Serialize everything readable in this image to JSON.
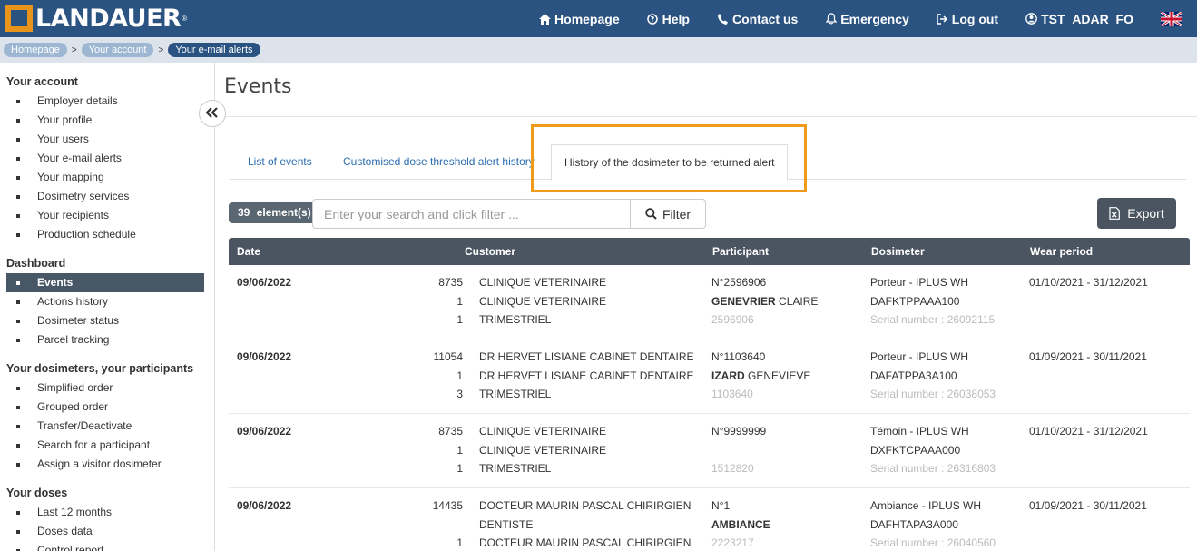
{
  "brand": {
    "name": "LANDAUER",
    "reg": "®"
  },
  "nav": {
    "homepage": "Homepage",
    "help": "Help",
    "contact": "Contact us",
    "emergency": "Emergency",
    "logout": "Log out",
    "user": "TST_ADAR_FO"
  },
  "breadcrumb": [
    "Homepage",
    "Your account",
    "Your e-mail alerts"
  ],
  "sidebar": {
    "sections": [
      {
        "title": "Your account",
        "items": [
          "Employer details",
          "Your profile",
          "Your users",
          "Your e-mail alerts",
          "Your mapping",
          "Dosimetry services",
          "Your recipients",
          "Production schedule"
        ]
      },
      {
        "title": "Dashboard",
        "items": [
          "Events",
          "Actions history",
          "Dosimeter status",
          "Parcel tracking"
        ]
      },
      {
        "title": "Your dosimeters, your participants",
        "items": [
          "Simplified order",
          "Grouped order",
          "Transfer/Deactivate",
          "Search for a participant",
          "Assign a visitor dosimeter"
        ]
      },
      {
        "title": "Your doses",
        "items": [
          "Last 12 months",
          "Doses data",
          "Control report"
        ]
      }
    ],
    "active_item": "Events"
  },
  "page": {
    "title": "Events"
  },
  "tabs": [
    "List of events",
    "Customised dose threshold alert history",
    "History of the dosimeter to be returned alert"
  ],
  "toolbar": {
    "count": "39",
    "count_label": "element(s)",
    "search_placeholder": "Enter your search and click filter ...",
    "filter_label": "Filter",
    "export_label": "Export"
  },
  "table": {
    "headers": [
      "Date",
      "Customer",
      "Participant",
      "Dosimeter",
      "Wear period"
    ],
    "rows": [
      {
        "date": "09/06/2022",
        "numbers": [
          "8735",
          "1",
          "1"
        ],
        "customer": [
          "CLINIQUE VETERINAIRE",
          "CLINIQUE VETERINAIRE",
          "TRIMESTRIEL"
        ],
        "participant_id": "N°2596906",
        "participant_last": "GENEVRIER",
        "participant_first": "CLAIRE",
        "participant_code": "2596906",
        "dosimeter_type": "Porteur - IPLUS WH",
        "dosimeter_ref": "DAFKTPPAAA100",
        "serial": "Serial number : 26092115",
        "wear_period": "01/10/2021 - 31/12/2021"
      },
      {
        "date": "09/06/2022",
        "numbers": [
          "11054",
          "1",
          "3"
        ],
        "customer": [
          "DR HERVET LISIANE CABINET DENTAIRE",
          "DR HERVET LISIANE CABINET DENTAIRE",
          "TRIMESTRIEL"
        ],
        "participant_id": "N°1103640",
        "participant_last": "IZARD",
        "participant_first": "GENEVIEVE",
        "participant_code": "1103640",
        "dosimeter_type": "Porteur - IPLUS WH",
        "dosimeter_ref": "DAFATPPA3A100",
        "serial": "Serial number : 26038053",
        "wear_period": "01/09/2021 - 30/11/2021"
      },
      {
        "date": "09/06/2022",
        "numbers": [
          "8735",
          "1",
          "1"
        ],
        "customer": [
          "CLINIQUE VETERINAIRE",
          "CLINIQUE VETERINAIRE",
          "TRIMESTRIEL"
        ],
        "participant_id": "N°9999999",
        "participant_last": "",
        "participant_first": "",
        "participant_code": "1512820",
        "dosimeter_type": "Témoin - IPLUS WH",
        "dosimeter_ref": "DXFKTCPAAA000",
        "serial": "Serial number : 26316803",
        "wear_period": "01/10/2021 - 31/12/2021"
      },
      {
        "date": "09/06/2022",
        "numbers": [
          "14435",
          "",
          "1"
        ],
        "customer": [
          "DOCTEUR MAURIN PASCAL CHIRIRGIEN",
          "DENTISTE",
          "DOCTEUR MAURIN PASCAL CHIRIRGIEN"
        ],
        "participant_id": "N°1",
        "participant_last": "AMBIANCE",
        "participant_first": "",
        "participant_code": "2223217",
        "dosimeter_type": "Ambiance - IPLUS WH",
        "dosimeter_ref": "DAFHTAPA3A000",
        "serial": "Serial number : 26040560",
        "wear_period": "01/09/2021 - 30/11/2021"
      }
    ]
  }
}
